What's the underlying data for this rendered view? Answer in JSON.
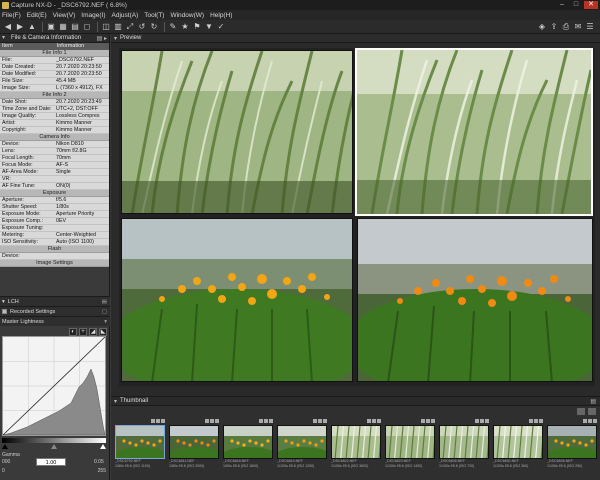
{
  "window": {
    "app_name": "Capture NX-D",
    "separator": " - ",
    "document": "_DSC6792.NEF ( 6.8%)",
    "buttons": [
      "–",
      "□",
      "✕"
    ]
  },
  "menu": [
    "File(F)",
    "Edit(E)",
    "View(V)",
    "Image(I)",
    "Adjust(A)",
    "Tool(T)",
    "Window(W)",
    "Help(H)"
  ],
  "toolbar": {
    "icons": [
      "back-icon",
      "forward-icon",
      "up-icon",
      "browse-icon",
      "grid-icon",
      "folder-icon",
      "single-view-icon",
      "compare-icon",
      "filmstrip-icon",
      "fullscreen-icon",
      "rotate-left-icon",
      "rotate-right-icon",
      "straighten-icon",
      "rating-star-icon",
      "label-icon",
      "filter-icon",
      "pick-icon",
      "nx-studio-icon",
      "export-icon",
      "print-icon",
      "mail-icon",
      "list-icon"
    ],
    "glyphs": [
      "◀",
      "▶",
      "▲",
      "▣",
      "▦",
      "▤",
      "◻",
      "◫",
      "▥",
      "⤢",
      "↺",
      "↻",
      "✎",
      "★",
      "⚑",
      "▼",
      "✓",
      "◈",
      "⇪",
      "⎙",
      "✉",
      "☰"
    ]
  },
  "info_panel": {
    "title": "File & Camera Information",
    "col_item": "Item",
    "col_info": "Information",
    "sections": [
      {
        "title": "File Info 1",
        "rows": [
          {
            "k": "File:",
            "v": "_DSC6792.NEF"
          },
          {
            "k": "Date Created:",
            "v": "20.7.2020 20:23:50"
          },
          {
            "k": "Date Modified:",
            "v": "20.7.2020 20:23:50"
          },
          {
            "k": "File Size:",
            "v": "45.4 MB"
          },
          {
            "k": "Image Size:",
            "v": "L (7360 x 4912), FX"
          }
        ]
      },
      {
        "title": "File Info 2",
        "rows": [
          {
            "k": "Date Shot:",
            "v": "20.7.2020 20:23:49"
          },
          {
            "k": "Time Zone and Date:",
            "v": "UTC+2, DST:OFF"
          },
          {
            "k": "Image Quality:",
            "v": "Lossless Compres"
          },
          {
            "k": "Artist:",
            "v": "Kimmo Manner"
          },
          {
            "k": "Copyright:",
            "v": "Kimmo Manner"
          }
        ]
      },
      {
        "title": "Camera Info",
        "rows": [
          {
            "k": "Device:",
            "v": "Nikon D810"
          },
          {
            "k": "Lens:",
            "v": "70mm f/2.8G"
          },
          {
            "k": "Focal Length:",
            "v": "70mm"
          },
          {
            "k": "Focus Mode:",
            "v": "AF-S"
          },
          {
            "k": "AF-Area Mode:",
            "v": "Single"
          },
          {
            "k": "VR:",
            "v": ""
          },
          {
            "k": "AF Fine Tune:",
            "v": "ON(0)"
          }
        ]
      },
      {
        "title": "Exposure",
        "rows": [
          {
            "k": "Aperture:",
            "v": "f/5.6"
          },
          {
            "k": "Shutter Speed:",
            "v": "1/80s"
          },
          {
            "k": "Exposure Mode:",
            "v": "Aperture Priority"
          },
          {
            "k": "Exposure Comp.:",
            "v": "0EV"
          },
          {
            "k": "Exposure Tuning:",
            "v": ""
          },
          {
            "k": "Metering:",
            "v": "Center-Weighted"
          },
          {
            "k": "ISO Sensitivity:",
            "v": "Auto (ISO 1100)"
          }
        ]
      },
      {
        "title": "Flash",
        "rows": [
          {
            "k": "Device:",
            "v": ""
          }
        ]
      },
      {
        "title": "Image Settings",
        "rows": []
      }
    ]
  },
  "lch_panel": {
    "title": "LCH",
    "recorded_settings": "Recorded Settings",
    "master_lightness": "Master Lightness",
    "gamma_label": "Gamma",
    "gamma_value": "1.00",
    "left_value": "000",
    "right_value": "0.05",
    "low_label": "0",
    "high_label": "255"
  },
  "preview": {
    "title": "Preview"
  },
  "thumbnail": {
    "title": "Thumbnail",
    "items": [
      {
        "cap": "_DSC6792.NEF",
        "cap2": "1/80s f/5.6 (ISO 1100)"
      },
      {
        "cap": "_DSC6811.NEF",
        "cap2": "1/80s f/5.6 (ISO 2000)"
      },
      {
        "cap": "_DSC6818.NEF",
        "cap2": "1/60s f/5.6 (ISO 1600)"
      },
      {
        "cap": "_DSC6819.NEF",
        "cap2": "1/100s f/5.6 (ISO 1250)"
      },
      {
        "cap": "_DSC6822.NEF",
        "cap2": "1/100s f/5.6 (ISO 3600)"
      },
      {
        "cap": "_DSC6823.NEF",
        "cap2": "1/100s f/5.6 (ISO 1400)"
      },
      {
        "cap": "_DSC6826.NEF",
        "cap2": "1/100s f/5.6 (ISO 720)"
      },
      {
        "cap": "_DSC6832.NEF",
        "cap2": "1/100s f/5.6 (ISO 360)"
      },
      {
        "cap": "_DSC6836.NEF",
        "cap2": "1/100s f/5.6 (ISO 250)"
      }
    ]
  }
}
